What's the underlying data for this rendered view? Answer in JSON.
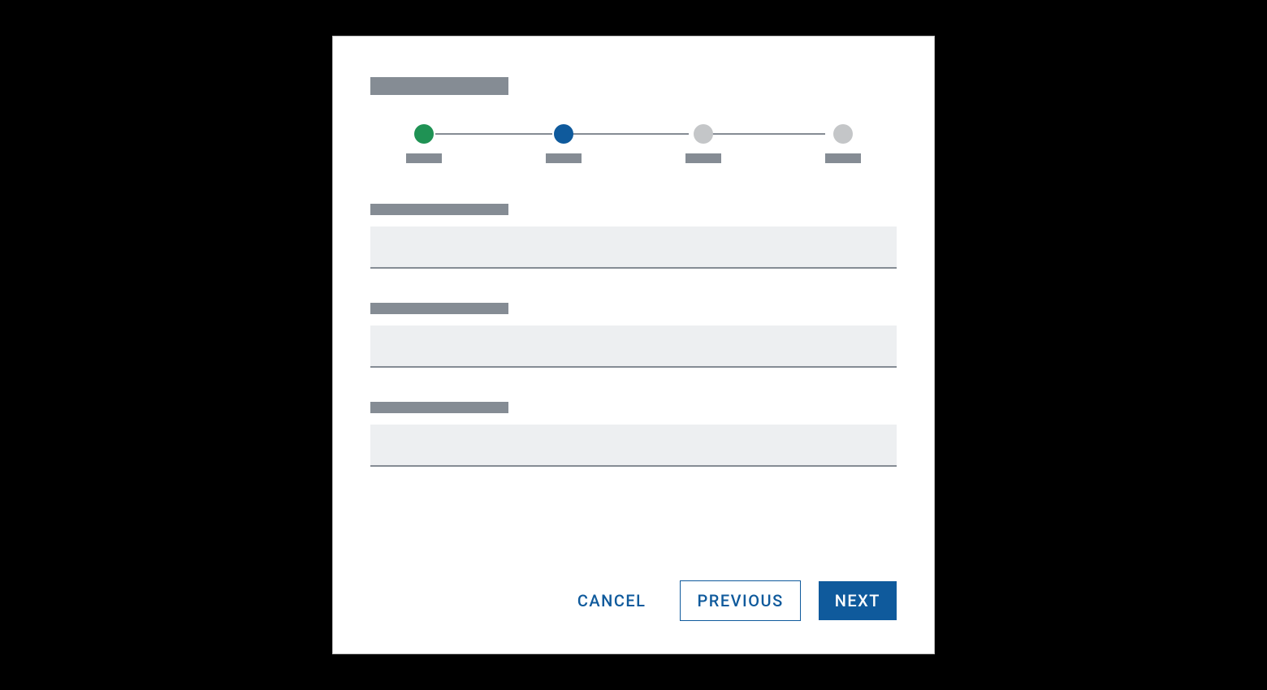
{
  "dialog": {
    "title": "",
    "steps": [
      {
        "label": "",
        "state": "complete"
      },
      {
        "label": "",
        "state": "current"
      },
      {
        "label": "",
        "state": "upcoming"
      },
      {
        "label": "",
        "state": "upcoming"
      }
    ],
    "fields": [
      {
        "label": "",
        "value": ""
      },
      {
        "label": "",
        "value": ""
      },
      {
        "label": "",
        "value": ""
      }
    ],
    "actions": {
      "cancel": "CANCEL",
      "previous": "PREVIOUS",
      "next": "NEXT"
    }
  },
  "colors": {
    "complete": "#1f9254",
    "current": "#0f5a9c",
    "upcoming": "#c4c6c8",
    "placeholder": "#858c94",
    "input_bg": "#edeff1",
    "primary": "#0f5a9c"
  }
}
